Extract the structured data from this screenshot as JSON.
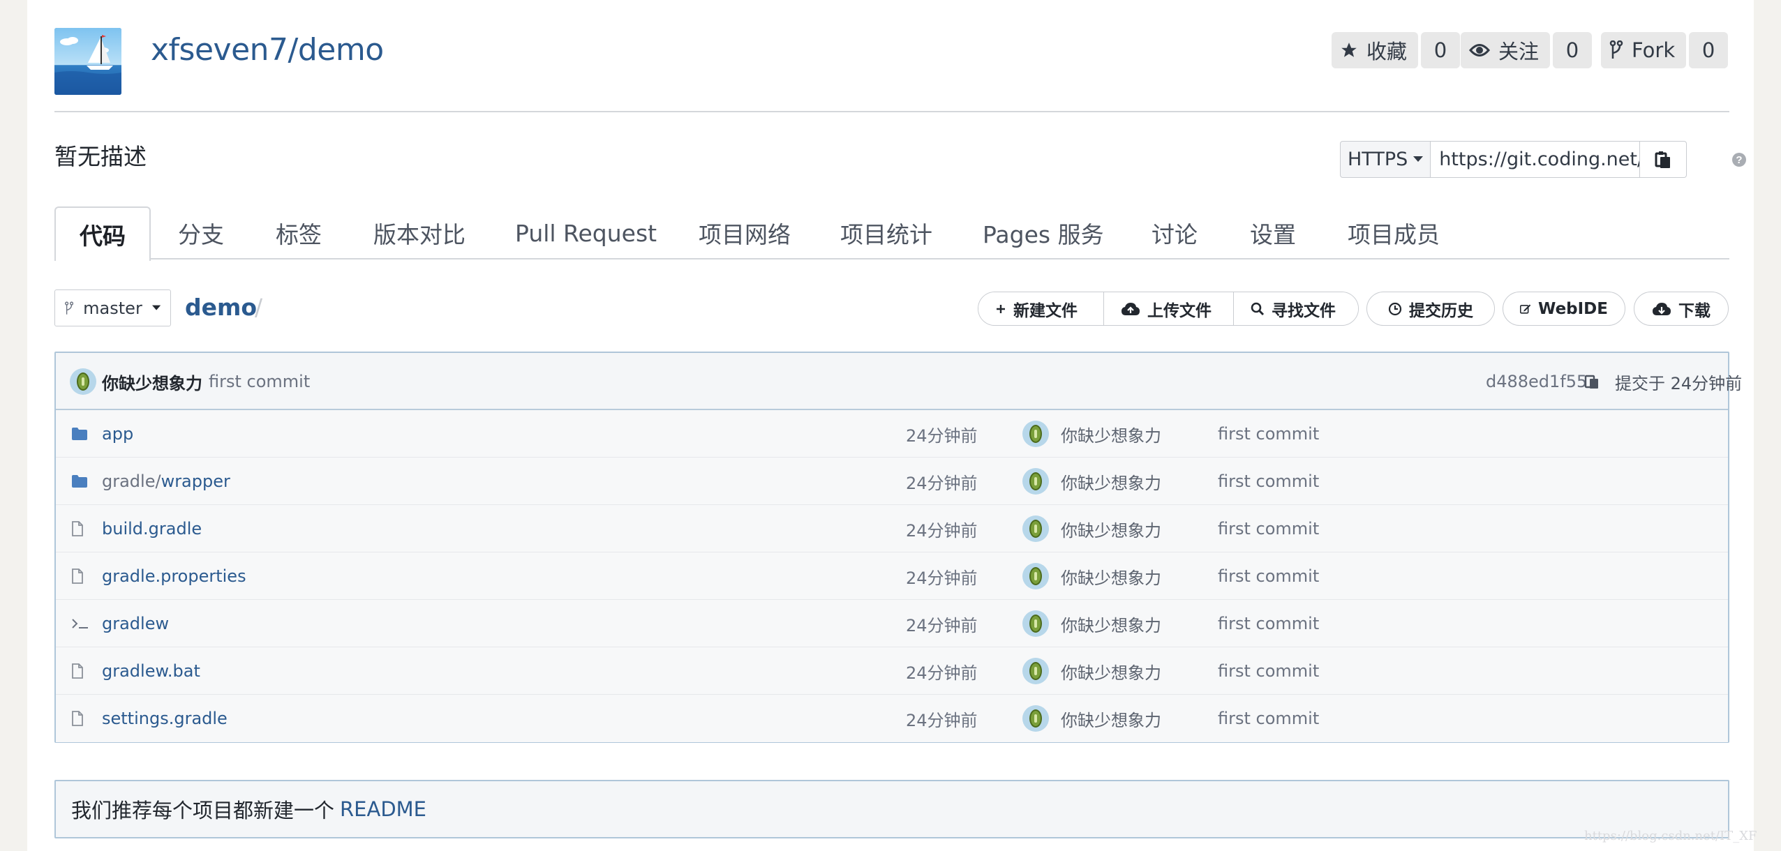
{
  "repo": {
    "full_name": "xfseven7/demo",
    "description": "暂无描述"
  },
  "counters": {
    "star": {
      "label": "收藏",
      "count": "0"
    },
    "watch": {
      "label": "关注",
      "count": "0"
    },
    "fork": {
      "label": "Fork",
      "count": "0"
    }
  },
  "clone": {
    "protocol": "HTTPS",
    "url": "https://git.coding.net/"
  },
  "tabs": [
    {
      "label": "代码",
      "active": true
    },
    {
      "label": "分支"
    },
    {
      "label": "标签"
    },
    {
      "label": "版本对比"
    },
    {
      "label": "Pull Request"
    },
    {
      "label": "项目网络"
    },
    {
      "label": "项目统计"
    },
    {
      "label": "Pages 服务"
    },
    {
      "label": "讨论"
    },
    {
      "label": "设置"
    },
    {
      "label": "项目成员"
    }
  ],
  "toolbar": {
    "branch": "master",
    "breadcrumb_root": "demo",
    "breadcrumb_sep": "/",
    "new_file": "新建文件",
    "upload_file": "上传文件",
    "find_file": "寻找文件",
    "history": "提交历史",
    "webide": "WebIDE",
    "download": "下载"
  },
  "last_commit": {
    "author": "你缺少想象力",
    "message": "first commit",
    "hash": "d488ed1f55",
    "time": "提交于 24分钟前"
  },
  "files": [
    {
      "icon": "folder-icon",
      "prefix": "",
      "name": "app",
      "time": "24分钟前",
      "author": "你缺少想象力",
      "message": "first commit"
    },
    {
      "icon": "folder-icon",
      "prefix": "gradle/",
      "name": "wrapper",
      "time": "24分钟前",
      "author": "你缺少想象力",
      "message": "first commit"
    },
    {
      "icon": "file-icon",
      "prefix": "",
      "name": "build.gradle",
      "time": "24分钟前",
      "author": "你缺少想象力",
      "message": "first commit"
    },
    {
      "icon": "file-icon",
      "prefix": "",
      "name": "gradle.properties",
      "time": "24分钟前",
      "author": "你缺少想象力",
      "message": "first commit"
    },
    {
      "icon": "terminal-icon",
      "prefix": "",
      "name": "gradlew",
      "time": "24分钟前",
      "author": "你缺少想象力",
      "message": "first commit"
    },
    {
      "icon": "file-icon",
      "prefix": "",
      "name": "gradlew.bat",
      "time": "24分钟前",
      "author": "你缺少想象力",
      "message": "first commit"
    },
    {
      "icon": "file-icon",
      "prefix": "",
      "name": "settings.gradle",
      "time": "24分钟前",
      "author": "你缺少想象力",
      "message": "first commit"
    }
  ],
  "readme_prompt": {
    "text": "我们推荐每个项目都新建一个",
    "link": "README"
  },
  "watermark": "https://blog.csdn.net/IT_XF",
  "colors": {
    "link": "#2b5a8f",
    "border": "#c9ccd1",
    "panel_border": "#afc6d9",
    "folder": "#4a7fbf"
  }
}
